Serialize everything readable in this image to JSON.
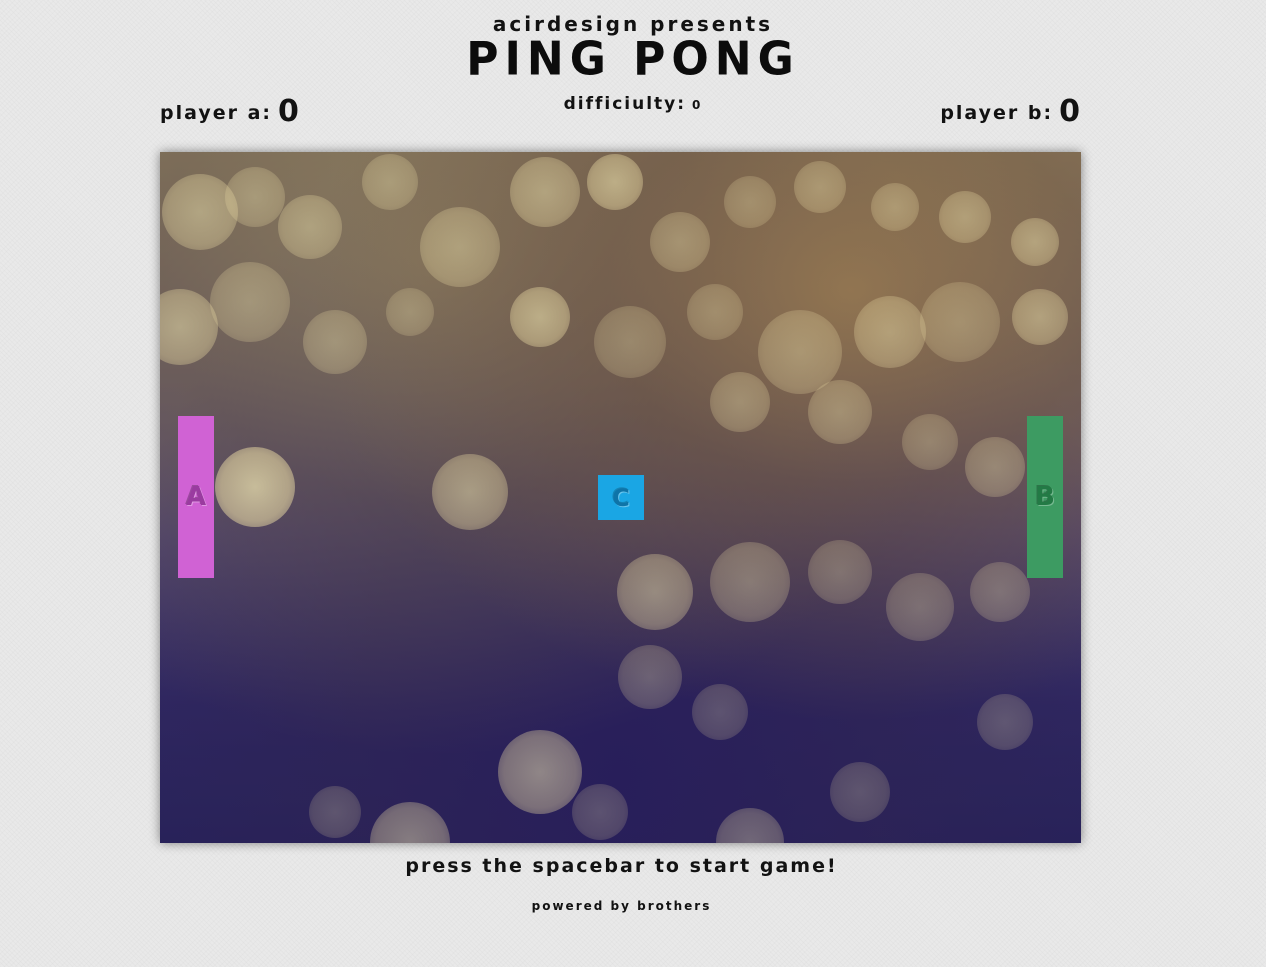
{
  "header": {
    "subtitle": "acirdesign presents",
    "title": "PING PONG"
  },
  "scoreboard": {
    "player_a_label": "player a:",
    "player_a_score": "0",
    "difficulty_label": "difficiulty:",
    "difficulty_value": "0",
    "player_b_label": "player b:",
    "player_b_score": "0"
  },
  "board": {
    "paddle_a_letter": "A",
    "paddle_a_color": "#d062d4",
    "paddle_b_letter": "B",
    "paddle_b_color": "#3d9b62",
    "ball_letter": "C",
    "ball_color": "#1aa6e4"
  },
  "footer": {
    "prompt": "press the spacebar to start game!",
    "credit": "powered by brothers"
  }
}
